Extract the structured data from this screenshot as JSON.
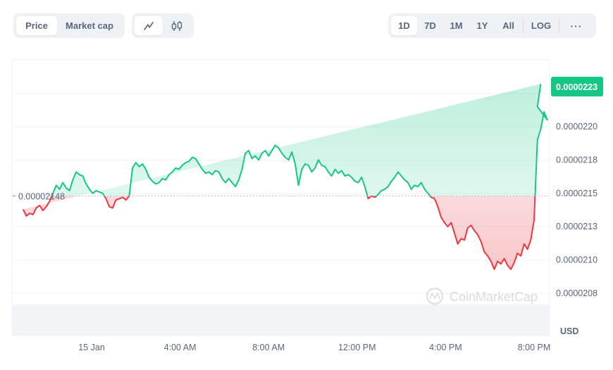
{
  "toolbar": {
    "metric_tabs": [
      {
        "label": "Price",
        "active": true
      },
      {
        "label": "Market cap",
        "active": false
      }
    ],
    "chart_type_buttons": [
      {
        "icon": "line-chart-icon",
        "active": true
      },
      {
        "icon": "candlestick-icon",
        "active": false
      }
    ],
    "range_tabs": [
      {
        "label": "1D",
        "active": true
      },
      {
        "label": "7D",
        "active": false
      },
      {
        "label": "1M",
        "active": false
      },
      {
        "label": "1Y",
        "active": false
      },
      {
        "label": "All",
        "active": false
      }
    ],
    "log_label": "LOG",
    "more_label": "···"
  },
  "colors": {
    "up": "#16c784",
    "down": "#ea3943",
    "badge": "#16c784",
    "axis_text": "#58667e",
    "grid": "#eff2f5"
  },
  "watermark": "CoinMarketCap",
  "chart_data": {
    "type": "area",
    "title": "",
    "xlabel": "",
    "ylabel": "USD",
    "currency_label": "USD",
    "value_scale": 1e-08,
    "baseline": 2148,
    "baseline_label": "0.00002148",
    "current_price_label": "0.0000223",
    "current_price": 2230,
    "ylim": [
      2050,
      2245
    ],
    "yticks": [
      {
        "value": 2200,
        "label": "0.0000220"
      },
      {
        "value": 2175,
        "label": "0.0000218"
      },
      {
        "value": 2150,
        "label": "0.0000215"
      },
      {
        "value": 2125,
        "label": "0.0000213"
      },
      {
        "value": 2100,
        "label": "0.0000210"
      },
      {
        "value": 2075,
        "label": "0.0000208"
      }
    ],
    "xlim": [
      -3.2,
      20.75
    ],
    "xticks": [
      {
        "value": 0,
        "label": "15 Jan"
      },
      {
        "value": 4,
        "label": "4:00 AM"
      },
      {
        "value": 8,
        "label": "8:00 AM"
      },
      {
        "value": 12,
        "label": "12:00 PM"
      },
      {
        "value": 16,
        "label": "4:00 PM"
      },
      {
        "value": 20,
        "label": "8:00 PM"
      }
    ],
    "grid": true,
    "x_unit": "hours since 15 Jan 00:00",
    "series": [
      {
        "name": "Price",
        "x": [
          -3.1,
          -2.95,
          -2.8,
          -2.65,
          -2.5,
          -2.35,
          -2.2,
          -2.05,
          -1.9,
          -1.75,
          -1.6,
          -1.45,
          -1.3,
          -1.15,
          -1.0,
          -0.85,
          -0.7,
          -0.55,
          -0.4,
          -0.25,
          -0.1,
          0.05,
          0.2,
          0.35,
          0.5,
          0.65,
          0.8,
          0.95,
          1.1,
          1.25,
          1.4,
          1.55,
          1.7,
          1.85,
          2.0,
          2.15,
          2.3,
          2.45,
          2.6,
          2.75,
          2.9,
          3.05,
          3.2,
          3.35,
          3.5,
          3.65,
          3.8,
          3.95,
          4.1,
          4.25,
          4.4,
          4.55,
          4.7,
          4.85,
          5.0,
          5.15,
          5.3,
          5.45,
          5.6,
          5.75,
          5.9,
          6.05,
          6.2,
          6.35,
          6.5,
          6.65,
          6.8,
          6.95,
          7.1,
          7.25,
          7.4,
          7.55,
          7.7,
          7.85,
          8.0,
          8.15,
          8.3,
          8.45,
          8.6,
          8.75,
          8.9,
          9.05,
          9.2,
          9.35,
          9.5,
          9.65,
          9.8,
          9.95,
          10.1,
          10.25,
          10.4,
          10.55,
          10.7,
          10.85,
          11.0,
          11.15,
          11.3,
          11.45,
          11.6,
          11.75,
          11.9,
          12.05,
          12.2,
          12.35,
          12.5,
          12.65,
          12.8,
          12.95,
          13.1,
          13.25,
          13.4,
          13.55,
          13.7,
          13.85,
          14.0,
          14.15,
          14.3,
          14.45,
          14.6,
          14.75,
          14.9,
          15.05,
          15.2,
          15.35,
          15.5,
          15.65,
          15.8,
          15.95,
          16.1,
          16.25,
          16.4,
          16.55,
          16.7,
          16.85,
          17.0,
          17.15,
          17.3,
          17.45,
          17.6,
          17.75,
          17.9,
          18.05,
          18.2,
          18.35,
          18.5,
          18.65,
          18.8,
          18.95,
          19.1,
          19.25,
          19.4,
          19.55,
          19.7,
          19.85,
          20.0,
          20.15,
          20.3,
          20.45,
          20.6
        ],
        "values": [
          2138,
          2133,
          2135,
          2134,
          2139,
          2141,
          2137,
          2140,
          2144,
          2150,
          2156,
          2153,
          2158,
          2154,
          2152,
          2160,
          2166,
          2164,
          2163,
          2157,
          2153,
          2150,
          2152,
          2151,
          2150,
          2146,
          2140,
          2139,
          2145,
          2146,
          2147,
          2145,
          2148,
          2169,
          2173,
          2170,
          2172,
          2168,
          2162,
          2159,
          2157,
          2158,
          2161,
          2160,
          2164,
          2166,
          2169,
          2168,
          2171,
          2173,
          2174,
          2177,
          2176,
          2172,
          2168,
          2165,
          2166,
          2164,
          2167,
          2166,
          2161,
          2158,
          2161,
          2158,
          2155,
          2160,
          2168,
          2180,
          2182,
          2176,
          2178,
          2175,
          2180,
          2182,
          2178,
          2182,
          2186,
          2184,
          2180,
          2177,
          2175,
          2181,
          2172,
          2156,
          2168,
          2172,
          2171,
          2166,
          2169,
          2175,
          2171,
          2170,
          2166,
          2163,
          2168,
          2165,
          2167,
          2163,
          2164,
          2162,
          2159,
          2158,
          2162,
          2155,
          2146,
          2148,
          2147,
          2149,
          2152,
          2153,
          2155,
          2159,
          2162,
          2166,
          2163,
          2160,
          2158,
          2153,
          2156,
          2155,
          2158,
          2153,
          2150,
          2147,
          2146,
          2140,
          2132,
          2128,
          2125,
          2128,
          2120,
          2112,
          2116,
          2115,
          2124,
          2126,
          2122,
          2119,
          2114,
          2106,
          2103,
          2099,
          2093,
          2099,
          2097,
          2101,
          2096,
          2093,
          2098,
          2105,
          2103,
          2112,
          2108,
          2115,
          2130,
          2190
        ],
        "x_tail": [
          20.15,
          20.3,
          20.45,
          20.6,
          20.75
        ],
        "values_tail": [
          2198,
          2211,
          2205,
          2215,
          2232
        ]
      }
    ]
  }
}
